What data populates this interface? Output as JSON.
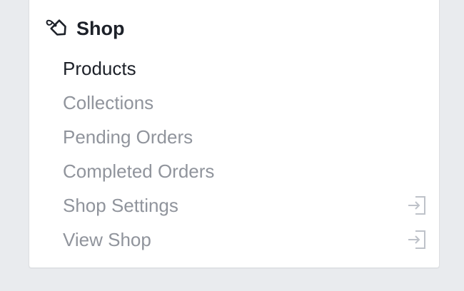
{
  "section": {
    "title": "Shop",
    "icon": "price-tag-icon"
  },
  "menu": {
    "items": [
      {
        "label": "Products",
        "active": true,
        "trailing_icon": null
      },
      {
        "label": "Collections",
        "active": false,
        "trailing_icon": null
      },
      {
        "label": "Pending Orders",
        "active": false,
        "trailing_icon": null
      },
      {
        "label": "Completed Orders",
        "active": false,
        "trailing_icon": null
      },
      {
        "label": "Shop Settings",
        "active": false,
        "trailing_icon": "open-external-icon"
      },
      {
        "label": "View Shop",
        "active": false,
        "trailing_icon": "open-external-icon"
      }
    ]
  },
  "colors": {
    "background": "#e9ebee",
    "active_text": "#1d2129",
    "inactive_text": "#90949c",
    "icon_gray": "#bec2c9"
  }
}
